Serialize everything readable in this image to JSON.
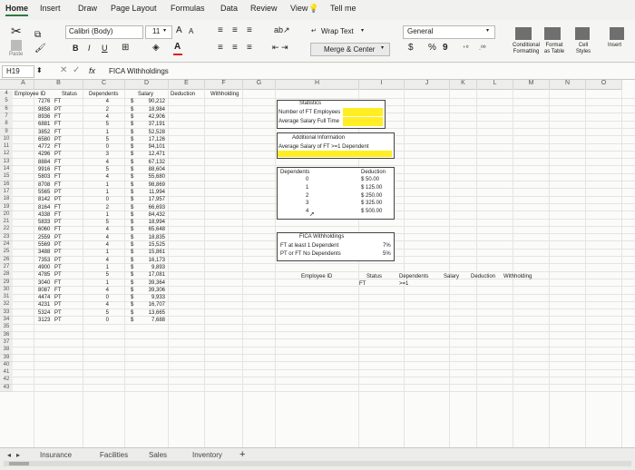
{
  "ribbon_tabs": [
    "Home",
    "Insert",
    "Draw",
    "Page Layout",
    "Formulas",
    "Data",
    "Review",
    "View",
    "Tell me"
  ],
  "ribbon": {
    "paste_label": "Paste",
    "font_name": "Calibri (Body)",
    "font_size": "11",
    "font_grow": "A",
    "font_shrink": "A",
    "bold": "B",
    "italic": "I",
    "underline": "U",
    "wrap_text": "Wrap Text",
    "merge_center": "Merge & Center",
    "number_format": "General",
    "currency": "$",
    "percent": "%",
    "comma": "9",
    "conditional_formatting": "Conditional Formatting",
    "format_as_table": "Format as Table",
    "cell_styles": "Cell Styles",
    "insert": "Insert"
  },
  "formula_bar": {
    "name_box": "H19",
    "fx": "fx",
    "content": "FICA Withholdings"
  },
  "columns": [
    "A",
    "B",
    "C",
    "D",
    "E",
    "F",
    "G",
    "H",
    "I",
    "J",
    "K",
    "L",
    "M",
    "N",
    "O"
  ],
  "headers": {
    "employee_id": "Employee ID",
    "status": "Status",
    "dependents": "Dependents",
    "salary": "Salary",
    "deduction": "Deduction",
    "withholding": "Withholding"
  },
  "rows": [
    {
      "r": "4",
      "id": "",
      "st": "",
      "dep": "",
      "sal": ""
    },
    {
      "r": "5",
      "id": "7276",
      "st": "FT",
      "dep": "4",
      "sal": "90,212"
    },
    {
      "r": "6",
      "id": "9858",
      "st": "PT",
      "dep": "2",
      "sal": "18,984"
    },
    {
      "r": "7",
      "id": "8936",
      "st": "FT",
      "dep": "4",
      "sal": "42,906"
    },
    {
      "r": "8",
      "id": "6881",
      "st": "FT",
      "dep": "5",
      "sal": "37,191"
    },
    {
      "r": "9",
      "id": "3852",
      "st": "FT",
      "dep": "1",
      "sal": "52,528"
    },
    {
      "r": "10",
      "id": "6580",
      "st": "PT",
      "dep": "5",
      "sal": "17,126"
    },
    {
      "r": "11",
      "id": "4772",
      "st": "FT",
      "dep": "0",
      "sal": "94,101"
    },
    {
      "r": "12",
      "id": "4296",
      "st": "PT",
      "dep": "3",
      "sal": "12,471"
    },
    {
      "r": "13",
      "id": "8884",
      "st": "FT",
      "dep": "4",
      "sal": "67,132"
    },
    {
      "r": "14",
      "id": "9916",
      "st": "FT",
      "dep": "5",
      "sal": "88,604"
    },
    {
      "r": "15",
      "id": "5803",
      "st": "FT",
      "dep": "4",
      "sal": "55,680"
    },
    {
      "r": "16",
      "id": "8708",
      "st": "FT",
      "dep": "1",
      "sal": "98,869"
    },
    {
      "r": "17",
      "id": "5565",
      "st": "PT",
      "dep": "1",
      "sal": "11,994"
    },
    {
      "r": "18",
      "id": "8142",
      "st": "PT",
      "dep": "0",
      "sal": "17,957"
    },
    {
      "r": "19",
      "id": "8164",
      "st": "FT",
      "dep": "2",
      "sal": "66,693"
    },
    {
      "r": "20",
      "id": "4338",
      "st": "FT",
      "dep": "1",
      "sal": "84,432"
    },
    {
      "r": "21",
      "id": "5833",
      "st": "PT",
      "dep": "5",
      "sal": "18,994"
    },
    {
      "r": "22",
      "id": "6060",
      "st": "FT",
      "dep": "4",
      "sal": "65,648"
    },
    {
      "r": "23",
      "id": "2559",
      "st": "PT",
      "dep": "4",
      "sal": "18,835"
    },
    {
      "r": "24",
      "id": "5569",
      "st": "PT",
      "dep": "4",
      "sal": "15,525"
    },
    {
      "r": "25",
      "id": "3488",
      "st": "PT",
      "dep": "1",
      "sal": "15,861"
    },
    {
      "r": "26",
      "id": "7353",
      "st": "PT",
      "dep": "4",
      "sal": "16,173"
    },
    {
      "r": "27",
      "id": "4900",
      "st": "PT",
      "dep": "1",
      "sal": "9,893"
    },
    {
      "r": "28",
      "id": "4785",
      "st": "PT",
      "dep": "5",
      "sal": "17,081"
    },
    {
      "r": "29",
      "id": "3040",
      "st": "FT",
      "dep": "1",
      "sal": "39,364"
    },
    {
      "r": "30",
      "id": "8087",
      "st": "FT",
      "dep": "4",
      "sal": "39,306"
    },
    {
      "r": "31",
      "id": "4474",
      "st": "PT",
      "dep": "0",
      "sal": "9,933"
    },
    {
      "r": "32",
      "id": "4231",
      "st": "PT",
      "dep": "4",
      "sal": "16,707"
    },
    {
      "r": "33",
      "id": "5324",
      "st": "PT",
      "dep": "5",
      "sal": "13,665"
    },
    {
      "r": "34",
      "id": "3123",
      "st": "PT",
      "dep": "0",
      "sal": "7,688"
    },
    {
      "r": "35",
      "id": "",
      "st": "",
      "dep": "",
      "sal": ""
    },
    {
      "r": "36",
      "id": "",
      "st": "",
      "dep": "",
      "sal": ""
    },
    {
      "r": "37",
      "id": "",
      "st": "",
      "dep": "",
      "sal": ""
    },
    {
      "r": "38",
      "id": "",
      "st": "",
      "dep": "",
      "sal": ""
    },
    {
      "r": "39",
      "id": "",
      "st": "",
      "dep": "",
      "sal": ""
    },
    {
      "r": "40",
      "id": "",
      "st": "",
      "dep": "",
      "sal": ""
    },
    {
      "r": "41",
      "id": "",
      "st": "",
      "dep": "",
      "sal": ""
    },
    {
      "r": "42",
      "id": "",
      "st": "",
      "dep": "",
      "sal": ""
    },
    {
      "r": "43",
      "id": "",
      "st": "",
      "dep": "",
      "sal": ""
    }
  ],
  "currency_symbol": "$",
  "statistics": {
    "title": "Statistics",
    "ft_count": "Number of FT Employees",
    "avg_salary": "Average Salary Full Time"
  },
  "additional": {
    "title": "Additional Information",
    "avg_dep": "Average Salary of FT >=1 Dependent"
  },
  "dependents_table": {
    "h1": "Dependents",
    "h2": "Deduction",
    "rows": [
      {
        "d": "0",
        "v": "$ 50.00"
      },
      {
        "d": "1",
        "v": "$ 125.00"
      },
      {
        "d": "2",
        "v": "$ 250.00"
      },
      {
        "d": "3",
        "v": "$ 325.00"
      },
      {
        "d": "4",
        "v": "$ 500.00"
      }
    ]
  },
  "fica": {
    "title": "FICA Withholdings",
    "r1_label": "FT at least 1 Dependent",
    "r1_val": "7%",
    "r2_label": "PT or FT No Dependents",
    "r2_val": "5%"
  },
  "criteria": {
    "employee_id": "Employee ID",
    "status": "Status",
    "dependents": "Dependents",
    "salary": "Salary",
    "deduction": "Deduction",
    "withholding": "Withholding",
    "status_val": "FT",
    "dep_val": ">=1"
  },
  "sheet_tabs": [
    "Insurance",
    "Facilities",
    "Sales",
    "Inventory"
  ],
  "add_sheet": "+",
  "colors": {
    "highlight": "#ffee22",
    "accent": "#2f7a3f"
  }
}
